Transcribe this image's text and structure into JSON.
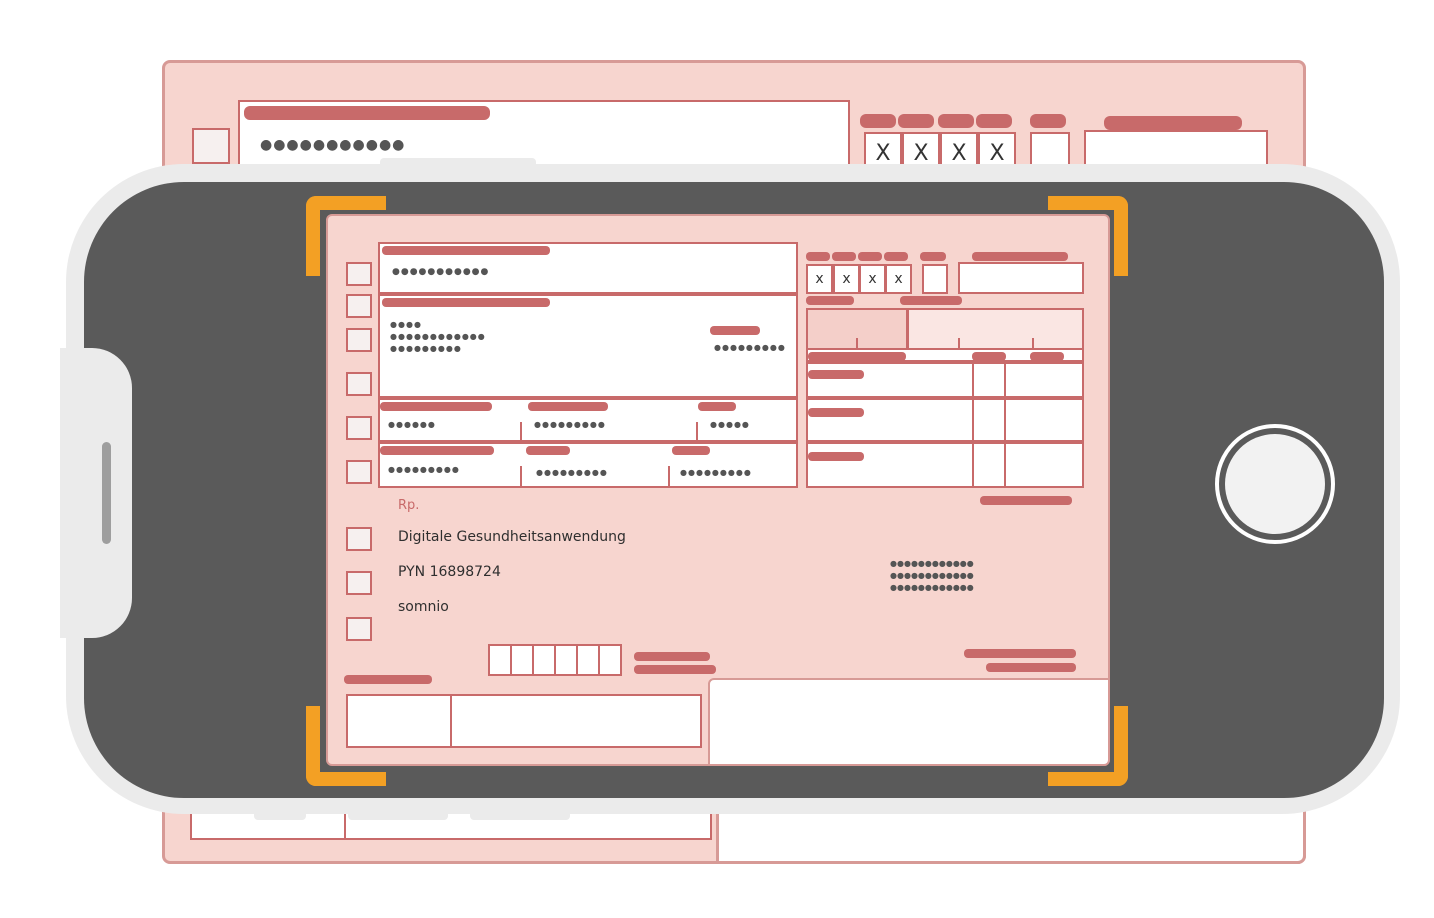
{
  "prescription": {
    "rp_label": "Rp.",
    "line1": "Digitale Gesundheitsanwendung",
    "line2": "PYN 16898724",
    "line3": "somnio",
    "x_marks": [
      "x",
      "x",
      "x",
      "x"
    ],
    "masked": {
      "insurance_no": "●●●●●●●●●●●",
      "name_a": "●●●●",
      "name_b": "●●●●●●●●●●●●",
      "name_c": "●●●●●●●●●",
      "birthdate": "●●●●●●●●●",
      "kassen": "●●●●●●",
      "versicherten": "●●●●●●●●●",
      "status": "●●●●●",
      "betriebs": "●●●●●●●●●",
      "arzt": "●●●●●●●●●",
      "datum": "●●●●●●●●●",
      "stamp_1": "●●●●●●●●●●●●",
      "stamp_2": "●●●●●●●●●●●●",
      "stamp_3": "●●●●●●●●●●●●"
    }
  },
  "background_form": {
    "x_marks": [
      "X",
      "X",
      "X",
      "X"
    ],
    "masked": "●●●●●●●●●●●"
  },
  "colors": {
    "form_fill": "#f7d5cf",
    "form_border": "#c86a6a",
    "bar": "#c86a6a",
    "phone_frame": "#ebebeb",
    "phone_screen": "#5a5a5a",
    "corner_marker": "#f3a024"
  }
}
